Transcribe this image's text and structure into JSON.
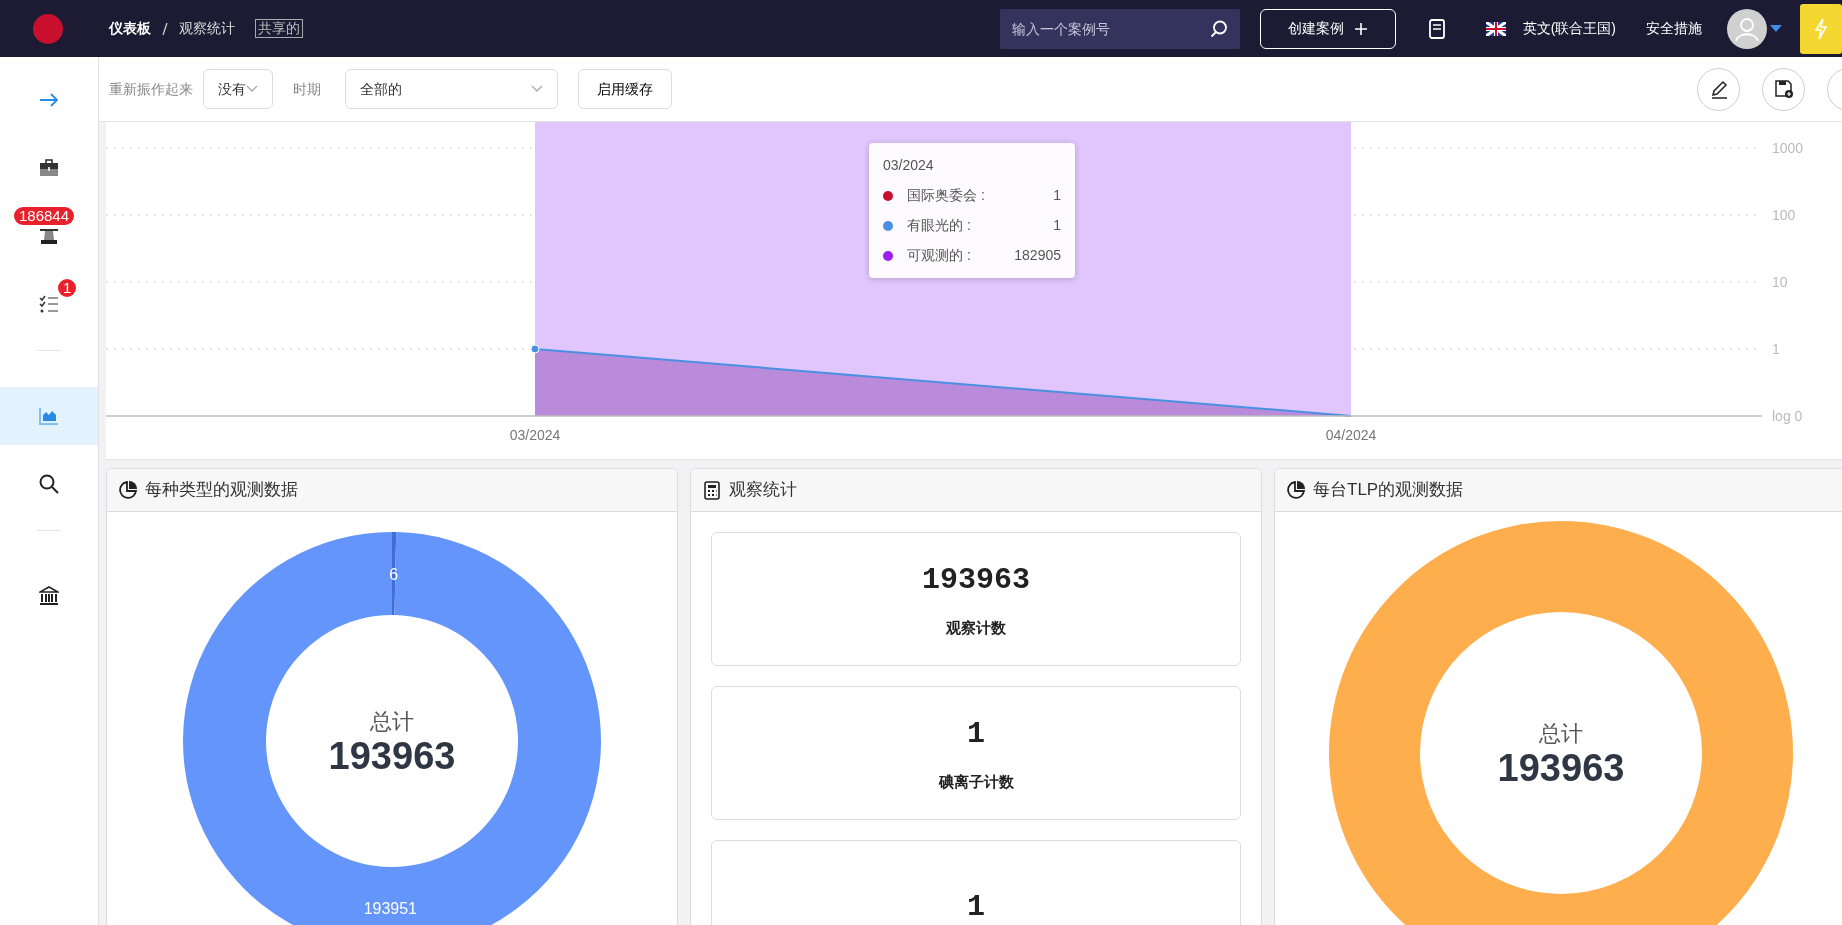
{
  "topbar": {
    "breadcrumb": [
      "仪表板",
      "观察统计"
    ],
    "shared_tag": "共享的",
    "search": {
      "placeholder": "输入一个案例号"
    },
    "create_button": "创建案例",
    "language": "英文(联合王国)",
    "security": "安全措施"
  },
  "sidebar": {
    "items": [
      {
        "kind": "arrow",
        "selected": false
      },
      {
        "kind": "briefcase",
        "selected": false
      },
      {
        "kind": "monitor",
        "selected": false,
        "badge": "186844"
      },
      {
        "kind": "tasks",
        "selected": false,
        "badge": "1"
      },
      {
        "kind": "divider"
      },
      {
        "kind": "chart",
        "selected": true
      },
      {
        "kind": "search",
        "selected": false
      },
      {
        "kind": "divider"
      },
      {
        "kind": "bank",
        "selected": false
      }
    ]
  },
  "toolbar": {
    "filters": [
      {
        "label": "重新振作起来",
        "value": "没有"
      },
      {
        "label": "时期",
        "value": "全部的"
      }
    ],
    "cache_button": "启用缓存"
  },
  "chart": {
    "y_axis_labels": [
      "1000",
      "100",
      "10",
      "1",
      "log 0"
    ],
    "x_axis_labels": [
      "03/2024",
      "04/2024"
    ],
    "tooltip": {
      "title": "03/2024",
      "rows": [
        {
          "label": "国际奥委会 :",
          "value": "1",
          "color": "#c8102e"
        },
        {
          "label": "有眼光的 :",
          "value": "1",
          "color": "#4a90e2"
        },
        {
          "label": "可观测的 :",
          "value": "182905",
          "color": "#9b1ff0"
        }
      ]
    }
  },
  "cards": [
    {
      "kind": "donut",
      "title": "每种类型的观测数据",
      "center_label": "总计",
      "center_value": "193963",
      "chart_data": {
        "type": "donut",
        "values": [
          6,
          193951
        ],
        "data_labels": true
      }
    },
    {
      "kind": "stats",
      "title": "观察统计",
      "stats": [
        {
          "value": "193963",
          "label": "观察计数"
        },
        {
          "value": "1",
          "label": "碘离子计数"
        },
        {
          "value": "1"
        }
      ]
    },
    {
      "kind": "ring",
      "title": "每台TLP的观测数据",
      "center_label": "总计",
      "center_value": "193963"
    }
  ]
}
